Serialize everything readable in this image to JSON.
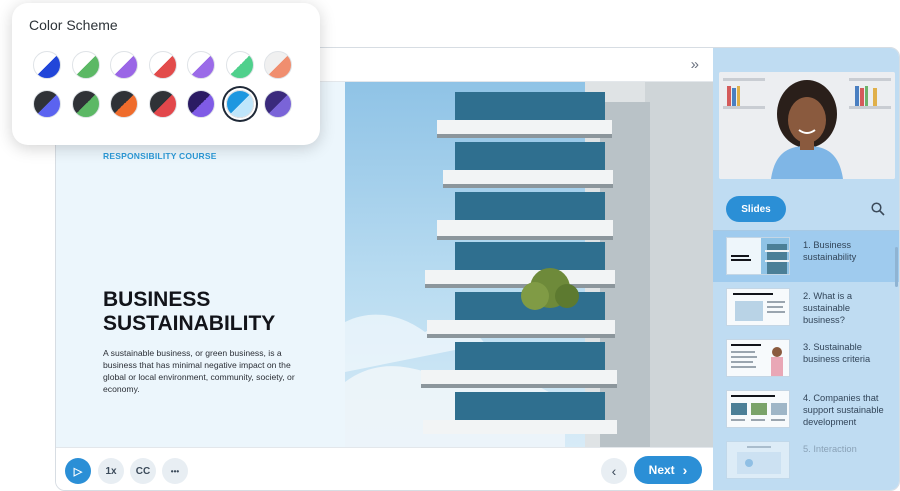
{
  "popover": {
    "title": "Color Scheme",
    "swatches_row1": [
      {
        "name": "white-blue",
        "a": "#ffffff",
        "b": "#2146d9"
      },
      {
        "name": "white-green",
        "a": "#ffffff",
        "b": "#5cb865"
      },
      {
        "name": "white-purple",
        "a": "#ffffff",
        "b": "#9a66e6"
      },
      {
        "name": "white-red",
        "a": "#ffffff",
        "b": "#e24b4b"
      },
      {
        "name": "white-violet",
        "a": "#ffffff",
        "b": "#9b6be8"
      },
      {
        "name": "white-mint",
        "a": "#ffffff",
        "b": "#4fd08c"
      },
      {
        "name": "salmon-white",
        "a": "#f0f0f0",
        "b": "#f08e6f"
      }
    ],
    "swatches_row2": [
      {
        "name": "dark-blue",
        "a": "#2f3237",
        "b": "#5b63f0"
      },
      {
        "name": "dark-green",
        "a": "#2f3237",
        "b": "#5cb865"
      },
      {
        "name": "dark-orange",
        "a": "#2f3237",
        "b": "#ef6c2c"
      },
      {
        "name": "dark-red",
        "a": "#2f3237",
        "b": "#e2474b"
      },
      {
        "name": "dark-purple",
        "a": "#2b1b63",
        "b": "#7f5be6"
      },
      {
        "name": "blue-selected",
        "a": "#1d97e0",
        "b": "#bfe6fb"
      },
      {
        "name": "indigo-purple",
        "a": "#3a2a7c",
        "b": "#7a64d8"
      }
    ]
  },
  "slide": {
    "kicker": "RESPONSIBILITY COURSE",
    "heading": "BUSINESS SUSTAINABILITY",
    "body": "A sustainable business, or green business, is a business that has minimal negative impact on the global or local environment, community, society, or economy."
  },
  "controls": {
    "speed_label": "1x",
    "cc_label": "CC",
    "more_label": "•••",
    "next_label": "Next"
  },
  "sidebar": {
    "slides_tab": "Slides",
    "items": [
      {
        "label": "1. Business sustainability",
        "active": true
      },
      {
        "label": "2. What is a sustainable business?",
        "active": false
      },
      {
        "label": "3. Sustainable business criteria",
        "active": false
      },
      {
        "label": "4. Companies that support sustainable development",
        "active": false
      },
      {
        "label": "5. Interaction",
        "active": false
      }
    ]
  },
  "colors": {
    "accent": "#2b8fd6",
    "sidebar_bg": "#bfdcf2",
    "slide_bg": "#ecf6fc"
  }
}
